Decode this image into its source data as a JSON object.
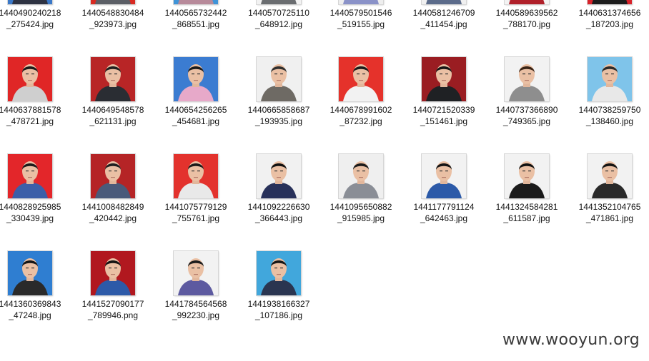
{
  "watermark": "www.wooyun.org",
  "files": [
    {
      "name1": "1440490240218",
      "name2": "_275424.jpg",
      "bg": "#3a78c8",
      "shirt": "#2d3242",
      "hair": "#1a1a1a"
    },
    {
      "name1": "1440548830484",
      "name2": "_923973.jpg",
      "bg": "#d82a22",
      "shirt": "#5b5f66",
      "hair": "#222"
    },
    {
      "name1": "1440565732442",
      "name2": "_868551.jpg",
      "bg": "#3f94d8",
      "shirt": "#b78a9a",
      "hair": "#2a2a2a"
    },
    {
      "name1": "1440570725110",
      "name2": "_648912.jpg",
      "bg": "#f2f2f2",
      "shirt": "#6a6d70",
      "hair": "#444"
    },
    {
      "name1": "1440579501546",
      "name2": "_519155.jpg",
      "bg": "#eeeeee",
      "shirt": "#8a92c8",
      "hair": "#333"
    },
    {
      "name1": "1440581246709",
      "name2": "_411454.jpg",
      "bg": "#f0f0f0",
      "shirt": "#5b6b8a",
      "hair": "#1c1c1c"
    },
    {
      "name1": "1440589639562",
      "name2": "_788170.jpg",
      "bg": "#f3f3f3",
      "shirt": "#b0202a",
      "hair": "#1d1d1d"
    },
    {
      "name1": "1440631374656",
      "name2": "_187203.jpg",
      "bg": "#d8222a",
      "shirt": "#1c1c1c",
      "hair": "#111"
    },
    {
      "name1": "1440637881578",
      "name2": "_478721.jpg",
      "bg": "#e02626",
      "shirt": "#cfcfcf",
      "hair": "#1a1a1a"
    },
    {
      "name1": "1440649548578",
      "name2": "_621131.jpg",
      "bg": "#b82526",
      "shirt": "#2a2d33",
      "hair": "#202020"
    },
    {
      "name1": "1440654256265",
      "name2": "_454681.jpg",
      "bg": "#3b7cd1",
      "shirt": "#e7a9c9",
      "hair": "#1a1a1a"
    },
    {
      "name1": "1440665858687",
      "name2": "_193935.jpg",
      "bg": "#f0f0f0",
      "shirt": "#6e6a64",
      "hair": "#303030"
    },
    {
      "name1": "1440678991602",
      "name2": "_87232.jpg",
      "bg": "#e5322b",
      "shirt": "#f2f2f2",
      "hair": "#1b1b1b"
    },
    {
      "name1": "1440721520339",
      "name2": "_151461.jpg",
      "bg": "#9a1d22",
      "shirt": "#1f2124",
      "hair": "#151515"
    },
    {
      "name1": "1440737366890",
      "name2": "_749365.jpg",
      "bg": "#f2f2f2",
      "shirt": "#8e8e8e",
      "hair": "#3a2416"
    },
    {
      "name1": "1440738259750",
      "name2": "_138460.jpg",
      "bg": "#7fc4ea",
      "shirt": "#e8e8e8",
      "hair": "#2b2b2b"
    },
    {
      "name1": "1440828925985",
      "name2": "_330439.jpg",
      "bg": "#e3262a",
      "shirt": "#3c5fa8",
      "hair": "#1a1a1a"
    },
    {
      "name1": "1441008482849",
      "name2": "_420442.jpg",
      "bg": "#b52426",
      "shirt": "#4a5a7a",
      "hair": "#202020"
    },
    {
      "name1": "1441075779129",
      "name2": "_755761.jpg",
      "bg": "#e3322d",
      "shirt": "#e9e9e9",
      "hair": "#1a1a1a"
    },
    {
      "name1": "1441092226630",
      "name2": "_366443.jpg",
      "bg": "#f1f1f1",
      "shirt": "#28315a",
      "hair": "#101010"
    },
    {
      "name1": "1441095650882",
      "name2": "_915985.jpg",
      "bg": "#efefef",
      "shirt": "#8a8e96",
      "hair": "#1c1c1c"
    },
    {
      "name1": "1441177791124",
      "name2": "_642463.jpg",
      "bg": "#f2f2f2",
      "shirt": "#2c5aa8",
      "hair": "#151515"
    },
    {
      "name1": "1441324584281",
      "name2": "_611587.jpg",
      "bg": "#f2f2f2",
      "shirt": "#1b1b1b",
      "hair": "#121212"
    },
    {
      "name1": "1441352104765",
      "name2": "_471861.jpg",
      "bg": "#f2f2f2",
      "shirt": "#2a2a2a",
      "hair": "#141414"
    },
    {
      "name1": "1441360369843",
      "name2": "_47248.jpg",
      "bg": "#2f7ed1",
      "shirt": "#2a2a2a",
      "hair": "#161616"
    },
    {
      "name1": "1441527090177",
      "name2": "_789946.png",
      "bg": "#b1181f",
      "shirt": "#2d5aa8",
      "hair": "#141414"
    },
    {
      "name1": "1441784564568",
      "name2": "_992230.jpg",
      "bg": "#f2f2f2",
      "shirt": "#5d5aa0",
      "hair": "#1d1d1d"
    },
    {
      "name1": "1441938166327",
      "name2": "_107186.jpg",
      "bg": "#41a7dc",
      "shirt": "#2a3550",
      "hair": "#161616"
    }
  ]
}
